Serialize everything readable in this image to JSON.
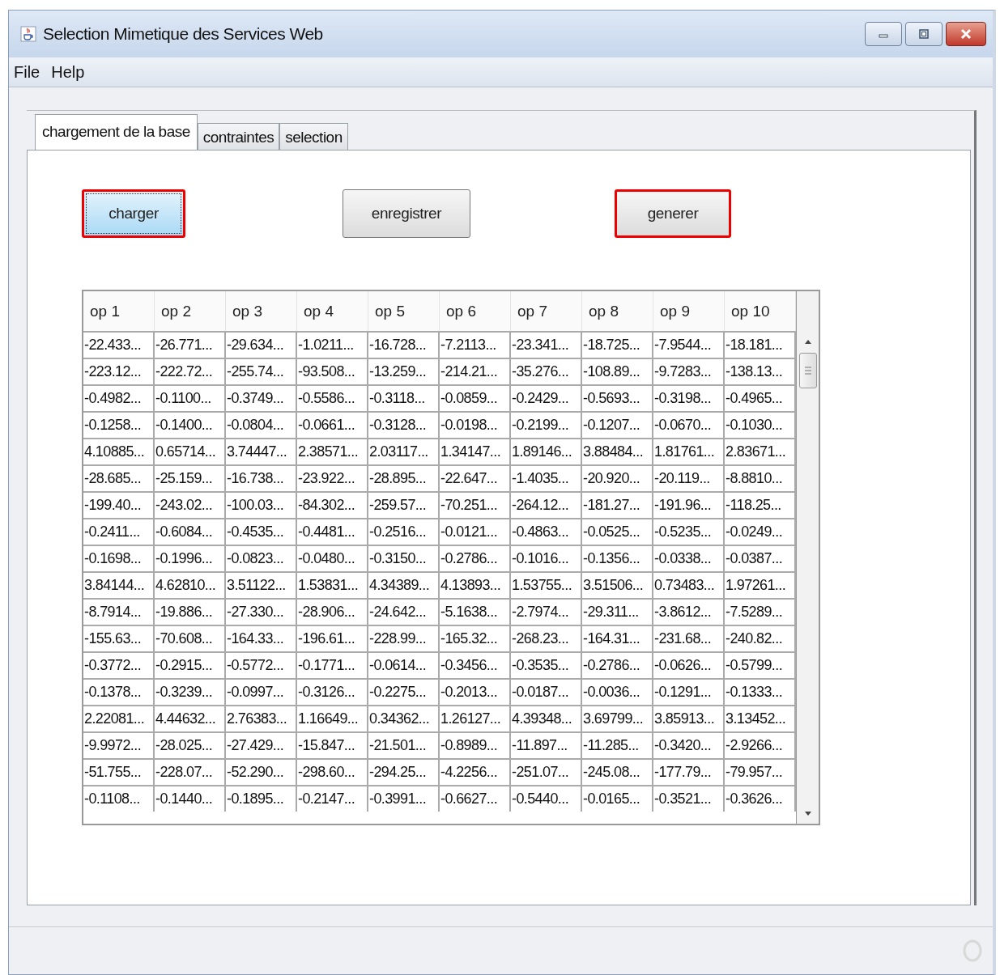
{
  "window": {
    "title": "Selection Mimetique des Services Web"
  },
  "menu": [
    "File",
    "Help"
  ],
  "tabs": [
    {
      "label": "chargement de la base",
      "selected": true
    },
    {
      "label": "contraintes",
      "selected": false
    },
    {
      "label": "selection",
      "selected": false
    }
  ],
  "buttons": [
    {
      "label": "charger",
      "focused": true,
      "outlined": true
    },
    {
      "label": "enregistrer",
      "focused": false,
      "outlined": false
    },
    {
      "label": "generer",
      "focused": false,
      "outlined": true
    }
  ],
  "table": {
    "columns": [
      "op 1",
      "op 2",
      "op 3",
      "op 4",
      "op 5",
      "op 6",
      "op 7",
      "op 8",
      "op 9",
      "op 10"
    ],
    "rows": [
      [
        "-22.433...",
        "-26.771...",
        "-29.634...",
        "-1.0211...",
        "-16.728...",
        "-7.2113...",
        "-23.341...",
        "-18.725...",
        "-7.9544...",
        "-18.181..."
      ],
      [
        "-223.12...",
        "-222.72...",
        "-255.74...",
        "-93.508...",
        "-13.259...",
        "-214.21...",
        "-35.276...",
        "-108.89...",
        "-9.7283...",
        "-138.13..."
      ],
      [
        "-0.4982...",
        "-0.1100...",
        "-0.3749...",
        "-0.5586...",
        "-0.3118...",
        "-0.0859...",
        "-0.2429...",
        "-0.5693...",
        "-0.3198...",
        "-0.4965..."
      ],
      [
        "-0.1258...",
        "-0.1400...",
        "-0.0804...",
        "-0.0661...",
        "-0.3128...",
        "-0.0198...",
        "-0.2199...",
        "-0.1207...",
        "-0.0670...",
        "-0.1030..."
      ],
      [
        "4.10885...",
        "0.65714...",
        "3.74447...",
        "2.38571...",
        "2.03117...",
        "1.34147...",
        "1.89146...",
        "3.88484...",
        "1.81761...",
        "2.83671..."
      ],
      [
        "-28.685...",
        "-25.159...",
        "-16.738...",
        "-23.922...",
        "-28.895...",
        "-22.647...",
        "-1.4035...",
        "-20.920...",
        "-20.119...",
        "-8.8810..."
      ],
      [
        "-199.40...",
        "-243.02...",
        "-100.03...",
        "-84.302...",
        "-259.57...",
        "-70.251...",
        "-264.12...",
        "-181.27...",
        "-191.96...",
        "-118.25..."
      ],
      [
        "-0.2411...",
        "-0.6084...",
        "-0.4535...",
        "-0.4481...",
        "-0.2516...",
        "-0.0121...",
        "-0.4863...",
        "-0.0525...",
        "-0.5235...",
        "-0.0249..."
      ],
      [
        "-0.1698...",
        "-0.1996...",
        "-0.0823...",
        "-0.0480...",
        "-0.3150...",
        "-0.2786...",
        "-0.1016...",
        "-0.1356...",
        "-0.0338...",
        "-0.0387..."
      ],
      [
        "3.84144...",
        "4.62810...",
        "3.51122...",
        "1.53831...",
        "4.34389...",
        "4.13893...",
        "1.53755...",
        "3.51506...",
        "0.73483...",
        "1.97261..."
      ],
      [
        "-8.7914...",
        "-19.886...",
        "-27.330...",
        "-28.906...",
        "-24.642...",
        "-5.1638...",
        "-2.7974...",
        "-29.311...",
        "-3.8612...",
        "-7.5289..."
      ],
      [
        "-155.63...",
        "-70.608...",
        "-164.33...",
        "-196.61...",
        "-228.99...",
        "-165.32...",
        "-268.23...",
        "-164.31...",
        "-231.68...",
        "-240.82..."
      ],
      [
        "-0.3772...",
        "-0.2915...",
        "-0.5772...",
        "-0.1771...",
        "-0.0614...",
        "-0.3456...",
        "-0.3535...",
        "-0.2786...",
        "-0.0626...",
        "-0.5799..."
      ],
      [
        "-0.1378...",
        "-0.3239...",
        "-0.0997...",
        "-0.3126...",
        "-0.2275...",
        "-0.2013...",
        "-0.0187...",
        "-0.0036...",
        "-0.1291...",
        "-0.1333..."
      ],
      [
        "2.22081...",
        "4.44632...",
        "2.76383...",
        "1.16649...",
        "0.34362...",
        "1.26127...",
        "4.39348...",
        "3.69799...",
        "3.85913...",
        "3.13452..."
      ],
      [
        "-9.9972...",
        "-28.025...",
        "-27.429...",
        "-15.847...",
        "-21.501...",
        "-0.8989...",
        "-11.897...",
        "-11.285...",
        "-0.3420...",
        "-2.9266..."
      ],
      [
        "-51.755...",
        "-228.07...",
        "-52.290...",
        "-298.60...",
        "-294.25...",
        "-4.2256...",
        "-251.07...",
        "-245.08...",
        "-177.79...",
        "-79.957..."
      ],
      [
        "-0.1108...",
        "-0.1440...",
        "-0.1895...",
        "-0.2147...",
        "-0.3991...",
        "-0.6627...",
        "-0.5440...",
        "-0.0165...",
        "-0.3521...",
        "-0.3626..."
      ]
    ]
  }
}
